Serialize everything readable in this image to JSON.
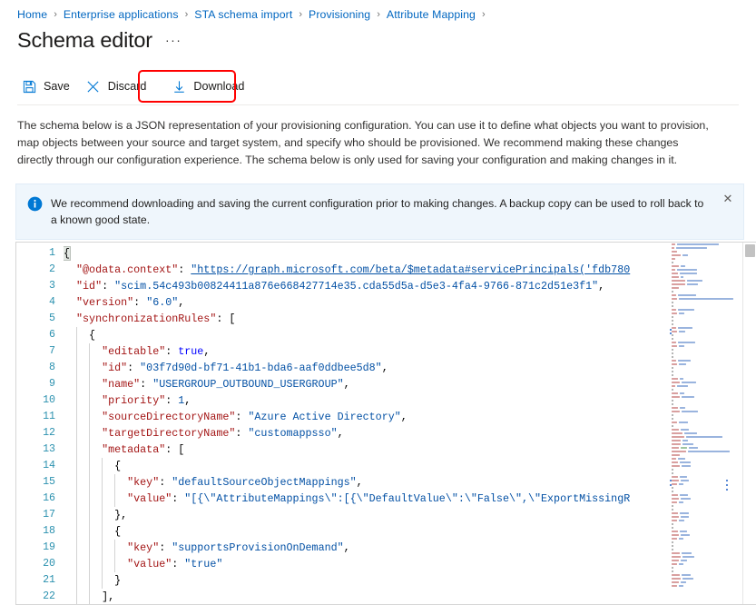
{
  "breadcrumb": {
    "items": [
      "Home",
      "Enterprise applications",
      "STA schema import",
      "Provisioning",
      "Attribute Mapping"
    ],
    "separator": "›",
    "trailing_separator": "›"
  },
  "header": {
    "title": "Schema editor",
    "more_actions": "···"
  },
  "toolbar": {
    "save_label": "Save",
    "discard_label": "Discard",
    "download_label": "Download",
    "save_icon": "save-floppy-icon",
    "discard_icon": "close-x-icon",
    "download_icon": "download-arrow-icon",
    "highlight_color": "#ff0000",
    "icon_color": "#0078d4"
  },
  "description": {
    "text": "The schema below is a JSON representation of your provisioning configuration. You can use it to define what objects you want to provision, map objects between your source and target system, and specify who should be provisioned. We recommend making these changes directly through our configuration experience. The schema below is only used for saving your configuration and making changes in it."
  },
  "banner": {
    "icon": "info-circle-icon",
    "text": "We recommend downloading and saving the current configuration prior to making changes. A backup copy can be used to roll back to a known good state.",
    "close_label": "✕",
    "background": "#eff6fc",
    "accent": "#0078d4"
  },
  "editor": {
    "language": "json",
    "cursor_line": 1,
    "first_visible_line": 1,
    "last_visible_line": 22,
    "lines": [
      {
        "no": "1",
        "indent": 0,
        "segments": [
          {
            "t": "{",
            "c": "cursor"
          }
        ]
      },
      {
        "no": "2",
        "indent": 0,
        "segments": [
          {
            "t": "  \"@odata.context\"",
            "c": "key"
          },
          {
            "t": ": ",
            "c": "punct"
          },
          {
            "t": "\"https://graph.microsoft.com/beta/$metadata#servicePrincipals('fdb780",
            "c": "url"
          }
        ]
      },
      {
        "no": "3",
        "indent": 0,
        "segments": [
          {
            "t": "  \"id\"",
            "c": "key"
          },
          {
            "t": ": ",
            "c": "punct"
          },
          {
            "t": "\"scim.54c493b00824411a876e668427714e35.cda55d5a-d5e3-4fa4-9766-871c2d51e3f1\"",
            "c": "str"
          },
          {
            "t": ",",
            "c": "punct"
          }
        ]
      },
      {
        "no": "4",
        "indent": 0,
        "segments": [
          {
            "t": "  \"version\"",
            "c": "key"
          },
          {
            "t": ": ",
            "c": "punct"
          },
          {
            "t": "\"6.0\"",
            "c": "str"
          },
          {
            "t": ",",
            "c": "punct"
          }
        ]
      },
      {
        "no": "5",
        "indent": 0,
        "segments": [
          {
            "t": "  \"synchronizationRules\"",
            "c": "key"
          },
          {
            "t": ": [",
            "c": "punct"
          }
        ]
      },
      {
        "no": "6",
        "indent": 1,
        "segments": [
          {
            "t": "    {",
            "c": "punct"
          }
        ]
      },
      {
        "no": "7",
        "indent": 2,
        "segments": [
          {
            "t": "      \"editable\"",
            "c": "key"
          },
          {
            "t": ": ",
            "c": "punct"
          },
          {
            "t": "true",
            "c": "bool"
          },
          {
            "t": ",",
            "c": "punct"
          }
        ]
      },
      {
        "no": "8",
        "indent": 2,
        "segments": [
          {
            "t": "      \"id\"",
            "c": "key"
          },
          {
            "t": ": ",
            "c": "punct"
          },
          {
            "t": "\"03f7d90d-bf71-41b1-bda6-aaf0ddbee5d8\"",
            "c": "str"
          },
          {
            "t": ",",
            "c": "punct"
          }
        ]
      },
      {
        "no": "9",
        "indent": 2,
        "segments": [
          {
            "t": "      \"name\"",
            "c": "key"
          },
          {
            "t": ": ",
            "c": "punct"
          },
          {
            "t": "\"USERGROUP_OUTBOUND_USERGROUP\"",
            "c": "str"
          },
          {
            "t": ",",
            "c": "punct"
          }
        ]
      },
      {
        "no": "10",
        "indent": 2,
        "segments": [
          {
            "t": "      \"priority\"",
            "c": "key"
          },
          {
            "t": ": ",
            "c": "punct"
          },
          {
            "t": "1",
            "c": "num"
          },
          {
            "t": ",",
            "c": "punct"
          }
        ]
      },
      {
        "no": "11",
        "indent": 2,
        "segments": [
          {
            "t": "      \"sourceDirectoryName\"",
            "c": "key"
          },
          {
            "t": ": ",
            "c": "punct"
          },
          {
            "t": "\"Azure Active Directory\"",
            "c": "str"
          },
          {
            "t": ",",
            "c": "punct"
          }
        ]
      },
      {
        "no": "12",
        "indent": 2,
        "segments": [
          {
            "t": "      \"targetDirectoryName\"",
            "c": "key"
          },
          {
            "t": ": ",
            "c": "punct"
          },
          {
            "t": "\"customappsso\"",
            "c": "str"
          },
          {
            "t": ",",
            "c": "punct"
          }
        ]
      },
      {
        "no": "13",
        "indent": 2,
        "segments": [
          {
            "t": "      \"metadata\"",
            "c": "key"
          },
          {
            "t": ": [",
            "c": "punct"
          }
        ]
      },
      {
        "no": "14",
        "indent": 3,
        "segments": [
          {
            "t": "        {",
            "c": "punct"
          }
        ]
      },
      {
        "no": "15",
        "indent": 4,
        "segments": [
          {
            "t": "          \"key\"",
            "c": "key"
          },
          {
            "t": ": ",
            "c": "punct"
          },
          {
            "t": "\"defaultSourceObjectMappings\"",
            "c": "str"
          },
          {
            "t": ",",
            "c": "punct"
          }
        ]
      },
      {
        "no": "16",
        "indent": 4,
        "segments": [
          {
            "t": "          \"value\"",
            "c": "key"
          },
          {
            "t": ": ",
            "c": "punct"
          },
          {
            "t": "\"[{\\\"AttributeMappings\\\":[{\\\"DefaultValue\\\":\\\"False\\\",\\\"ExportMissingR",
            "c": "str"
          }
        ]
      },
      {
        "no": "17",
        "indent": 3,
        "segments": [
          {
            "t": "        }",
            "c": "punct"
          },
          {
            "t": ",",
            "c": "punct"
          }
        ]
      },
      {
        "no": "18",
        "indent": 3,
        "segments": [
          {
            "t": "        {",
            "c": "punct"
          }
        ]
      },
      {
        "no": "19",
        "indent": 4,
        "segments": [
          {
            "t": "          \"key\"",
            "c": "key"
          },
          {
            "t": ": ",
            "c": "punct"
          },
          {
            "t": "\"supportsProvisionOnDemand\"",
            "c": "str"
          },
          {
            "t": ",",
            "c": "punct"
          }
        ]
      },
      {
        "no": "20",
        "indent": 4,
        "segments": [
          {
            "t": "          \"value\"",
            "c": "key"
          },
          {
            "t": ": ",
            "c": "punct"
          },
          {
            "t": "\"true\"",
            "c": "str"
          }
        ]
      },
      {
        "no": "21",
        "indent": 3,
        "segments": [
          {
            "t": "        }",
            "c": "punct"
          }
        ]
      },
      {
        "no": "22",
        "indent": 2,
        "segments": [
          {
            "t": "      ]",
            "c": "punct"
          },
          {
            "t": ",",
            "c": "punct"
          }
        ]
      }
    ],
    "minimap": {
      "visible": true,
      "rows": [
        [
          [
            4,
            "red"
          ],
          [
            46,
            "blue"
          ]
        ],
        [
          [
            3,
            "red"
          ],
          [
            34,
            "blue"
          ]
        ],
        [
          [
            6,
            "red"
          ]
        ],
        [
          [
            10,
            "red"
          ],
          [
            6,
            "blue"
          ]
        ],
        [
          [
            4,
            "red"
          ]
        ],
        [
          [
            2,
            "dark"
          ]
        ],
        [
          [
            8,
            "red"
          ],
          [
            5,
            "blue"
          ]
        ],
        [
          [
            4,
            "red"
          ],
          [
            22,
            "blue"
          ]
        ],
        [
          [
            7,
            "red"
          ],
          [
            19,
            "blue"
          ]
        ],
        [
          [
            8,
            "red"
          ],
          [
            3,
            "blue"
          ]
        ],
        [
          [
            15,
            "red"
          ],
          [
            17,
            "blue"
          ]
        ],
        [
          [
            15,
            "red"
          ],
          [
            12,
            "blue"
          ]
        ],
        [
          [
            8,
            "red"
          ]
        ],
        [
          [
            2,
            "dark"
          ]
        ],
        [
          [
            5,
            "red"
          ],
          [
            20,
            "blue"
          ]
        ],
        [
          [
            6,
            "red"
          ],
          [
            60,
            "blue"
          ]
        ],
        [
          [
            2,
            "dark"
          ]
        ],
        [
          [
            2,
            "dark"
          ]
        ],
        [
          [
            5,
            "red"
          ],
          [
            18,
            "blue"
          ]
        ],
        [
          [
            6,
            "red"
          ],
          [
            6,
            "blue"
          ]
        ],
        [
          [
            2,
            "dark"
          ]
        ],
        [
          [
            2,
            "dark"
          ]
        ],
        [
          [
            2,
            "dark"
          ]
        ],
        [
          [
            5,
            "red"
          ],
          [
            16,
            "blue"
          ]
        ],
        [
          [
            6,
            "red"
          ],
          [
            7,
            "blue"
          ]
        ],
        [
          [
            2,
            "dark"
          ]
        ],
        [
          [
            2,
            "dark"
          ]
        ],
        [
          [
            5,
            "red"
          ],
          [
            19,
            "blue"
          ]
        ],
        [
          [
            6,
            "red"
          ],
          [
            6,
            "blue"
          ]
        ],
        [
          [
            2,
            "dark"
          ]
        ],
        [
          [
            2,
            "dark"
          ]
        ],
        [
          [
            2,
            "dark"
          ]
        ],
        [
          [
            5,
            "red"
          ],
          [
            14,
            "blue"
          ]
        ],
        [
          [
            6,
            "red"
          ],
          [
            8,
            "blue"
          ]
        ],
        [
          [
            2,
            "dark"
          ]
        ],
        [
          [
            2,
            "dark"
          ]
        ],
        [
          [
            2,
            "dark"
          ]
        ],
        [
          [
            7,
            "red"
          ],
          [
            4,
            "blue"
          ]
        ],
        [
          [
            9,
            "red"
          ],
          [
            16,
            "blue"
          ]
        ],
        [
          [
            4,
            "red"
          ],
          [
            12,
            "blue"
          ]
        ],
        [
          [
            2,
            "dark"
          ]
        ],
        [
          [
            7,
            "red"
          ],
          [
            5,
            "blue"
          ]
        ],
        [
          [
            9,
            "red"
          ],
          [
            14,
            "blue"
          ]
        ],
        [
          [
            2,
            "dark"
          ]
        ],
        [
          [
            2,
            "dark"
          ]
        ],
        [
          [
            7,
            "red"
          ],
          [
            6,
            "blue"
          ]
        ],
        [
          [
            9,
            "red"
          ],
          [
            18,
            "blue"
          ]
        ],
        [
          [
            2,
            "dark"
          ]
        ],
        [
          [
            2,
            "dark"
          ]
        ],
        [
          [
            6,
            "red"
          ],
          [
            10,
            "blue"
          ]
        ],
        [
          [
            2,
            "dark"
          ]
        ],
        [
          [
            8,
            "red"
          ],
          [
            9,
            "blue"
          ]
        ],
        [
          [
            12,
            "red"
          ],
          [
            14,
            "blue"
          ]
        ],
        [
          [
            14,
            "red"
          ],
          [
            40,
            "blue"
          ]
        ],
        [
          [
            10,
            "red"
          ],
          [
            6,
            "blue"
          ]
        ],
        [
          [
            10,
            "red"
          ],
          [
            12,
            "blue"
          ]
        ],
        [
          [
            8,
            "red"
          ],
          [
            7,
            "green"
          ],
          [
            10,
            "blue"
          ]
        ],
        [
          [
            16,
            "red"
          ],
          [
            46,
            "blue"
          ]
        ],
        [
          [
            9,
            "red"
          ]
        ],
        [
          [
            5,
            "red"
          ],
          [
            8,
            "blue"
          ]
        ],
        [
          [
            7,
            "red"
          ],
          [
            12,
            "blue"
          ]
        ],
        [
          [
            9,
            "red"
          ],
          [
            10,
            "blue"
          ]
        ],
        [
          [
            2,
            "dark"
          ]
        ],
        [
          [
            2,
            "dark"
          ]
        ],
        [
          [
            7,
            "red"
          ],
          [
            8,
            "blue"
          ]
        ],
        [
          [
            8,
            "red"
          ],
          [
            9,
            "blue"
          ]
        ],
        [
          [
            6,
            "red"
          ],
          [
            5,
            "blue"
          ]
        ],
        [
          [
            2,
            "dark"
          ]
        ],
        [
          [
            2,
            "dark"
          ]
        ],
        [
          [
            7,
            "red"
          ],
          [
            9,
            "blue"
          ]
        ],
        [
          [
            8,
            "red"
          ],
          [
            11,
            "blue"
          ]
        ],
        [
          [
            6,
            "red"
          ],
          [
            5,
            "blue"
          ]
        ],
        [
          [
            2,
            "dark"
          ]
        ],
        [
          [
            2,
            "dark"
          ]
        ],
        [
          [
            7,
            "red"
          ],
          [
            10,
            "blue"
          ]
        ],
        [
          [
            8,
            "red"
          ],
          [
            9,
            "blue"
          ]
        ],
        [
          [
            6,
            "red"
          ],
          [
            6,
            "blue"
          ]
        ],
        [
          [
            2,
            "dark"
          ]
        ],
        [
          [
            2,
            "dark"
          ]
        ],
        [
          [
            7,
            "red"
          ],
          [
            8,
            "blue"
          ]
        ],
        [
          [
            8,
            "red"
          ],
          [
            10,
            "blue"
          ]
        ],
        [
          [
            6,
            "red"
          ],
          [
            5,
            "blue"
          ]
        ],
        [
          [
            2,
            "dark"
          ]
        ],
        [
          [
            2,
            "dark"
          ]
        ],
        [
          [
            2,
            "dark"
          ]
        ],
        [
          [
            9,
            "red"
          ],
          [
            11,
            "blue"
          ]
        ],
        [
          [
            10,
            "red"
          ],
          [
            13,
            "blue"
          ]
        ],
        [
          [
            8,
            "red"
          ],
          [
            7,
            "blue"
          ]
        ],
        [
          [
            6,
            "red"
          ],
          [
            5,
            "blue"
          ]
        ],
        [
          [
            2,
            "dark"
          ]
        ],
        [
          [
            2,
            "dark"
          ]
        ],
        [
          [
            9,
            "red"
          ],
          [
            10,
            "blue"
          ]
        ],
        [
          [
            10,
            "red"
          ],
          [
            12,
            "blue"
          ]
        ],
        [
          [
            8,
            "red"
          ],
          [
            6,
            "blue"
          ]
        ],
        [
          [
            6,
            "red"
          ],
          [
            5,
            "blue"
          ]
        ]
      ]
    },
    "scrollbar": {
      "thumb_position_pct": 0,
      "thumb_size_pct": 4
    }
  }
}
